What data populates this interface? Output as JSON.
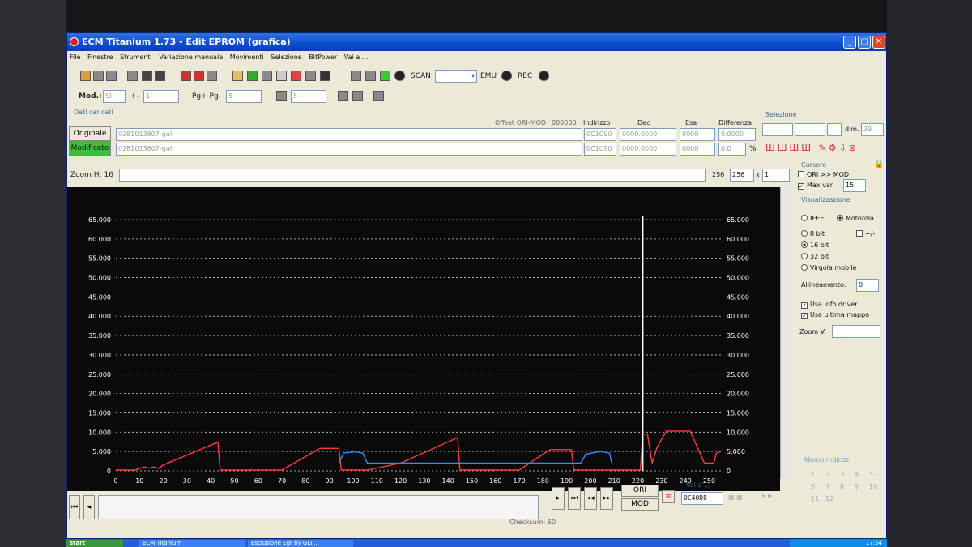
{
  "window": {
    "title": "ECM Titanium 1.73 - Edit EPROM (grafica)"
  },
  "menu": [
    "File",
    "Finestre",
    "Strumenti",
    "Variazione manuale",
    "Movimenti",
    "Selezione",
    "BitPower",
    "Vai a ..."
  ],
  "toolbar": {
    "scan_label": "SCAN",
    "emu_label": "EMU",
    "rec_label": "REC",
    "mod_label": "Mod.:",
    "mod_value": "SI",
    "plusminus_label": "+-",
    "plusminus_value": "1",
    "pg_label": "Pg+ Pg-",
    "pg_value": "5",
    "step_value": "5"
  },
  "loaded": {
    "group_label": "Dati caricati",
    "offset_label": "Offset ORI-MOD",
    "offset_value": "000000",
    "col_indirizzo": "Indirizzo",
    "col_dec": "Dec",
    "col_esa": "Esa",
    "col_diff": "Differenza",
    "originale_label": "Originale",
    "originale_file": "0281013807-gall",
    "originale_addr": "0C1C90",
    "originale_dec": "0000.0000",
    "originale_esa": "0000",
    "originale_diff": "0.0000",
    "modificato_label": "Modificato",
    "modificato_file": "0281013807-gall",
    "modificato_addr": "0C1C90",
    "modificato_dec": "0000.0000",
    "modificato_esa": "0000",
    "modificato_diff": "0.0",
    "percent": "%"
  },
  "selection": {
    "label": "Selezione",
    "dim_label": "dim.",
    "dim_value": "39"
  },
  "zoom": {
    "label": "Zoom H: 16",
    "val1": "256",
    "val2": "256",
    "times": "x",
    "mult": "1"
  },
  "cursor": {
    "label": "Cursore",
    "ori_mod": "ORI >> MOD",
    "max_var_label": "Max var.",
    "max_var_value": "15"
  },
  "view": {
    "label": "Visualizzazione",
    "ieee": "IEEE",
    "motorola": "Motorola",
    "bit8": "8 bit",
    "plusminus": "+/-",
    "bit16": "16 bit",
    "bit32": "32 bit",
    "float": "Virgola mobile",
    "align_label": "Allineamento:",
    "align_value": "0",
    "usa_info": "Usa info driver",
    "usa_ultima": "Usa ultima mappa",
    "zoom_v": "Zoom V:"
  },
  "memo": {
    "label": "Memo indirizzi",
    "numbers": [
      "1",
      "2",
      "3",
      "4",
      "5",
      "6",
      "7",
      "8",
      "9",
      "10",
      "11",
      "12"
    ]
  },
  "bottom": {
    "ori_btn": "ORI",
    "mod_btn": "MOD",
    "vai_label": "Vai a ...",
    "vai_value": "0C40D8",
    "checksum": "Checksum: 60"
  },
  "taskbar": {
    "start": "start",
    "item1": "ECM Titanium",
    "item2": "Esclusione Egr by GLI...",
    "clock": "17:54"
  },
  "colors": {
    "ori_series": "#ff3b3b",
    "mod_series": "#3b8cff",
    "cursor": "#ffffff",
    "title_bar": "#0b4fd0"
  },
  "chart_data": {
    "type": "line",
    "xlim": [
      0,
      256
    ],
    "ylim": [
      0,
      65000
    ],
    "x_ticks": [
      0,
      10,
      20,
      30,
      40,
      50,
      60,
      70,
      80,
      90,
      100,
      110,
      120,
      130,
      140,
      150,
      160,
      170,
      180,
      190,
      200,
      210,
      220,
      230,
      240,
      250
    ],
    "y_ticks": [
      0,
      5000,
      10000,
      15000,
      20000,
      25000,
      30000,
      35000,
      40000,
      45000,
      50000,
      55000,
      60000,
      65000
    ],
    "y_tick_labels": [
      "0",
      "5.000",
      "10.000",
      "15.000",
      "20.000",
      "25.000",
      "30.000",
      "35.000",
      "40.000",
      "45.000",
      "50.000",
      "55.000",
      "60.000",
      "65.000"
    ],
    "cursor_x": 222,
    "series": [
      {
        "x": [
          0,
          8,
          10,
          12,
          14,
          16,
          18,
          20,
          43,
          44,
          70,
          86,
          94,
          95,
          106,
          120,
          144,
          145,
          170,
          183,
          192,
          193,
          221,
          222,
          224,
          226,
          228,
          232,
          242,
          248,
          250,
          252,
          253,
          255
        ],
        "values": [
          200,
          200,
          600,
          1000,
          700,
          1000,
          600,
          1500,
          7400,
          200,
          200,
          5800,
          5800,
          200,
          200,
          2000,
          8600,
          200,
          200,
          5500,
          5500,
          200,
          200,
          9500,
          9500,
          2000,
          6000,
          10300,
          10300,
          2000,
          2000,
          2000,
          4500,
          5000
        ]
      },
      {
        "x": [
          94,
          96,
          101,
          104,
          106,
          196,
          198,
          204,
          208,
          209
        ],
        "values": [
          2000,
          4600,
          4900,
          4600,
          2000,
          2000,
          4300,
          5000,
          4600,
          2000
        ]
      }
    ]
  }
}
